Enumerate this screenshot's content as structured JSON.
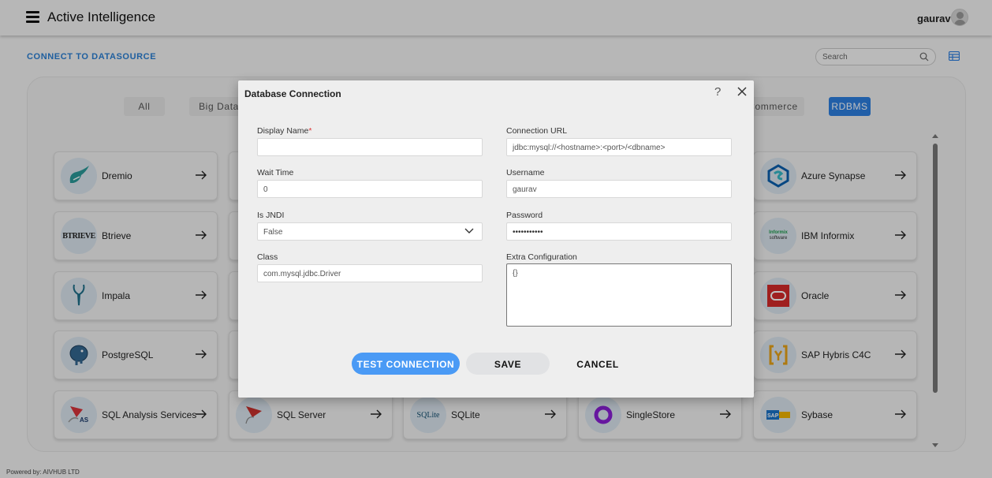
{
  "header": {
    "app_title": "Active Intelligence",
    "user_name": "gaurav",
    "menu_icon": "hamburger-menu-icon",
    "avatar_icon": "user-avatar-icon"
  },
  "page": {
    "section_title": "CONNECT TO DATASOURCE",
    "search": {
      "placeholder": "Search",
      "icon": "search-icon"
    },
    "view_toggle_icon": "grid-view-icon",
    "accent_color": "#2d7fe0"
  },
  "categories": [
    {
      "label": "All",
      "active": false
    },
    {
      "label": "Big Data",
      "active": false
    },
    {
      "label": "Commerce",
      "active": false
    },
    {
      "label": "RDBMS",
      "active": true
    }
  ],
  "datasources": {
    "column_1": [
      "Dremio",
      "Btrieve",
      "Impala",
      "PostgreSQL",
      "SQL Analysis Services"
    ],
    "column_2": [
      "SQL Server"
    ],
    "column_3": [
      "SQLite"
    ],
    "column_4": [
      "SingleStore"
    ],
    "column_5": [
      "Azure Synapse",
      "IBM Informix",
      "Oracle",
      "SAP Hybris C4C",
      "Sybase"
    ]
  },
  "dialog": {
    "title": "Database Connection",
    "help_label": "?",
    "fields": {
      "display_name": {
        "label": "Display Name",
        "required_mark": "*",
        "value": ""
      },
      "wait_time": {
        "label": "Wait Time",
        "value": "0"
      },
      "is_jndi": {
        "label": "Is JNDI",
        "value": "False"
      },
      "class": {
        "label": "Class",
        "value": "com.mysql.jdbc.Driver"
      },
      "connection_url": {
        "label": "Connection URL",
        "value": "jdbc:mysql://<hostname>:<port>/<dbname>"
      },
      "username": {
        "label": "Username",
        "value": "gaurav"
      },
      "password": {
        "label": "Password",
        "value": "•••••••••••"
      },
      "extra_configuration": {
        "label": "Extra Configuration",
        "value": "{}"
      }
    },
    "buttons": {
      "test_connection": "TEST CONNECTION",
      "save": "SAVE",
      "cancel": "CANCEL"
    }
  },
  "footer": {
    "text": "Powered by: AIVHUB LTD"
  }
}
